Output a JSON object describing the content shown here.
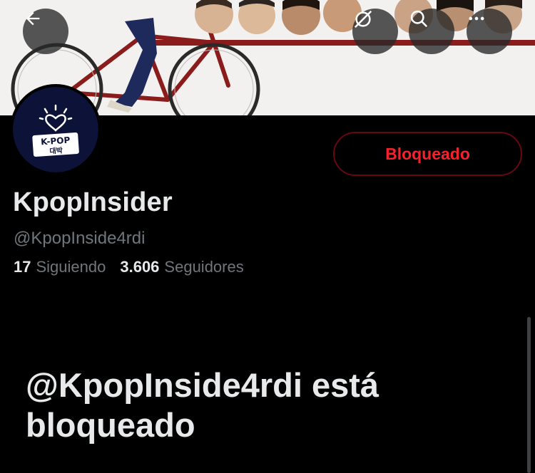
{
  "header": {
    "back_icon": "arrow-left-icon",
    "translate_icon": "translate-icon",
    "search_icon": "search-icon",
    "more_icon": "more-horizontal-icon"
  },
  "avatar": {
    "logo_top": "K-POP",
    "logo_bottom": "대박"
  },
  "profile": {
    "display_name": "KpopInsider",
    "handle": "@KpopInside4rdi",
    "following_count": "17",
    "following_label": "Siguiendo",
    "followers_count": "3.606",
    "followers_label": "Seguidores"
  },
  "actions": {
    "blocked_label": "Bloqueado"
  },
  "blocked_notice": {
    "message": "@KpopInside4rdi está bloqueado"
  },
  "colors": {
    "background": "#000000",
    "blocked_red": "#f4212e",
    "blocked_border": "#67070f",
    "muted_text": "#71767b",
    "primary_text": "#e7e9ea"
  }
}
